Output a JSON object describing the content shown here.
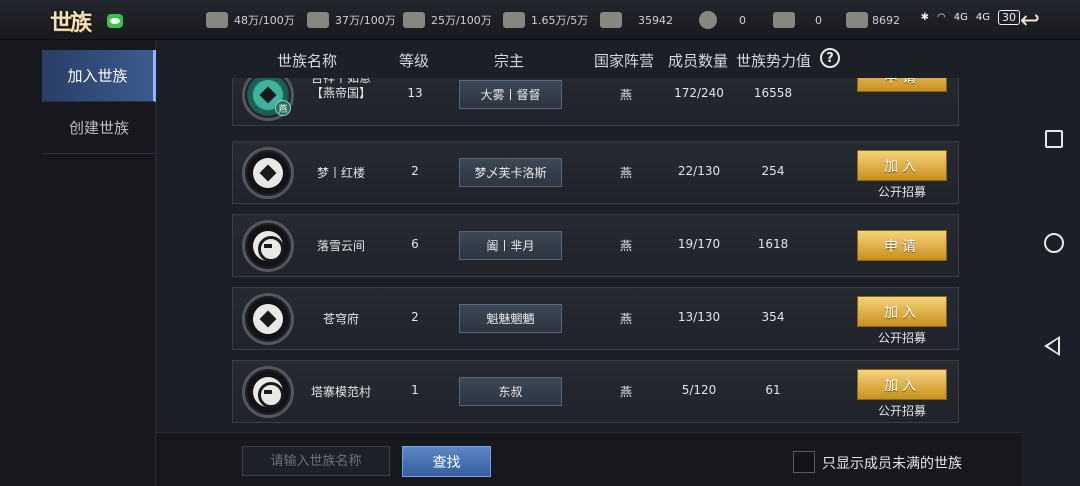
{
  "topbar": {
    "logo": "世族",
    "resources": [
      {
        "icon": "grain-icon",
        "value": "48万/100万"
      },
      {
        "icon": "wood-icon",
        "value": "37万/100万"
      },
      {
        "icon": "stone-icon",
        "value": "25万/100万"
      },
      {
        "icon": "iron-icon",
        "value": "1.65万/5万"
      },
      {
        "icon": "order-icon",
        "value": "35942"
      },
      {
        "icon": "coin-icon",
        "value": "0"
      },
      {
        "icon": "gold-icon",
        "value": "0"
      },
      {
        "icon": "silver-icon",
        "value": "8692"
      }
    ],
    "status": {
      "network1": "4G",
      "network2": "4G",
      "battery": "30"
    }
  },
  "sidebar": {
    "items": [
      {
        "label": "加入世族",
        "active": true
      },
      {
        "label": "创建世族",
        "active": false
      }
    ]
  },
  "table": {
    "headers": {
      "name": "世族名称",
      "level": "等级",
      "leader": "宗主",
      "nation": "国家阵营",
      "members": "成员数量",
      "power": "世族势力值"
    },
    "help_label": "?",
    "rows": [
      {
        "name_line1": "吉祥丨如意",
        "name_line2": "【燕帝国】",
        "level": "13",
        "leader": "大雾丨督督",
        "nation": "燕",
        "members": "172/240",
        "power": "16558",
        "action": "申请",
        "sub": "",
        "emblem_tag": "燕"
      },
      {
        "name_line1": "梦丨红楼",
        "name_line2": "",
        "level": "2",
        "leader": "梦乄芙卡洛斯",
        "nation": "燕",
        "members": "22/130",
        "power": "254",
        "action": "加入",
        "sub": "公开招募"
      },
      {
        "name_line1": "落雪云间",
        "name_line2": "",
        "level": "6",
        "leader": "阖丨芈月",
        "nation": "燕",
        "members": "19/170",
        "power": "1618",
        "action": "申请",
        "sub": ""
      },
      {
        "name_line1": "苍穹府",
        "name_line2": "",
        "level": "2",
        "leader": "魁魅魍魉",
        "nation": "燕",
        "members": "13/130",
        "power": "354",
        "action": "加入",
        "sub": "公开招募"
      },
      {
        "name_line1": "塔寨模范村",
        "name_line2": "",
        "level": "1",
        "leader": "东叔",
        "nation": "燕",
        "members": "5/120",
        "power": "61",
        "action": "加入",
        "sub": "公开招募"
      }
    ]
  },
  "footer": {
    "search_placeholder": "请输入世族名称",
    "search_button": "查找",
    "filter_label": "只显示成员未满的世族"
  },
  "colors": {
    "accent_gold": "#e0b048",
    "accent_blue": "#3b5a8e",
    "background": "#1c1f26"
  }
}
